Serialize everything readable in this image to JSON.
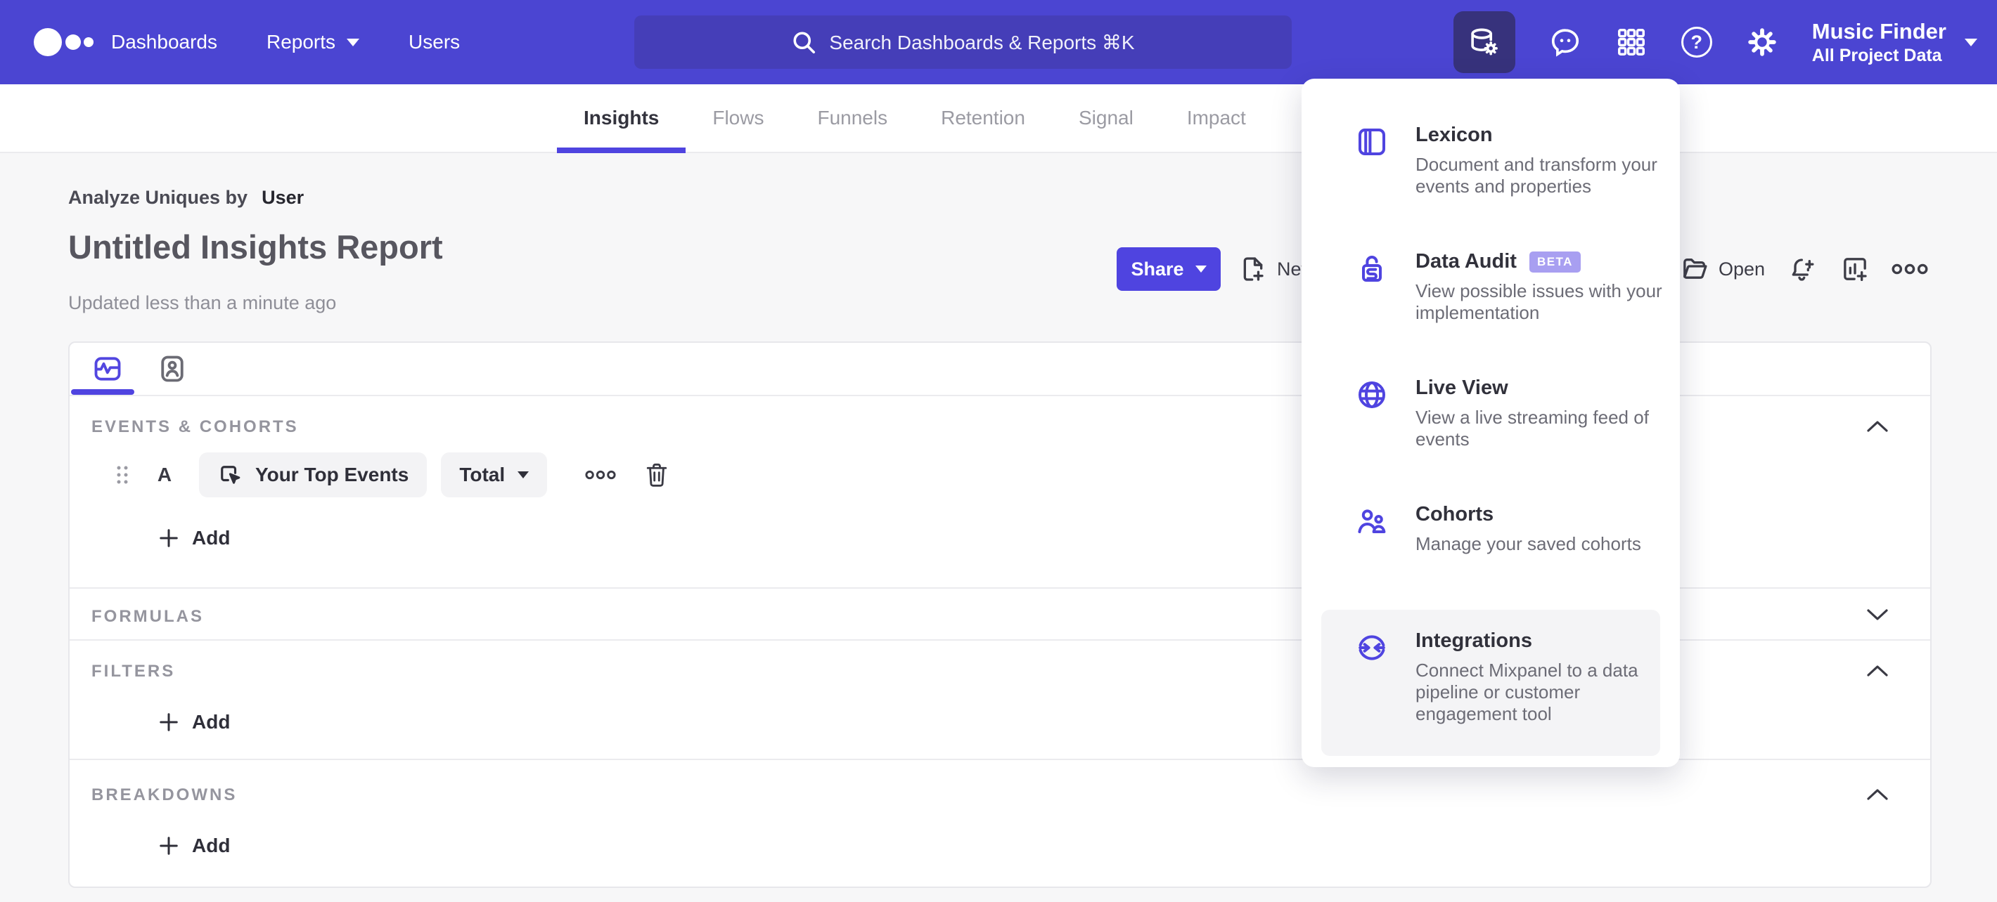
{
  "nav": {
    "items": [
      {
        "label": "Dashboards"
      },
      {
        "label": "Reports"
      },
      {
        "label": "Users"
      }
    ],
    "search_placeholder": "Search Dashboards & Reports ⌘K",
    "icons": [
      "mixpanel-logo",
      "data-management",
      "feedback",
      "apps-grid",
      "help",
      "settings"
    ],
    "help_glyph": "?",
    "project": {
      "name": "Music Finder",
      "scope": "All Project Data"
    }
  },
  "tabs": {
    "items": [
      "Insights",
      "Flows",
      "Funnels",
      "Retention",
      "Signal",
      "Impact"
    ],
    "active": "Insights"
  },
  "report": {
    "eyebrow_prefix": "Analyze Uniques by",
    "eyebrow_value": "User",
    "title": "Untitled Insights Report",
    "updated": "Updated less than a minute ago"
  },
  "toolbar": {
    "share_label": "Share",
    "new_label": "New",
    "open_label": "Open"
  },
  "builder": {
    "events": {
      "label": "EVENTS & COHORTS",
      "row_letter": "A",
      "event_name": "Your Top Events",
      "metric": "Total",
      "add_label": "Add"
    },
    "formulas": {
      "label": "FORMULAS"
    },
    "filters": {
      "label": "FILTERS",
      "add_label": "Add"
    },
    "breakdowns": {
      "label": "BREAKDOWNS",
      "add_label": "Add"
    }
  },
  "menu": {
    "items": [
      {
        "title": "Lexicon",
        "desc": "Document and transform your events and properties"
      },
      {
        "title": "Data Audit",
        "badge": "BETA",
        "desc": "View possible issues with your implementation"
      },
      {
        "title": "Live View",
        "desc": "View a live streaming feed of events"
      },
      {
        "title": "Cohorts",
        "desc": "Manage your saved cohorts"
      },
      {
        "title": "Integrations",
        "desc": "Connect Mixpanel to a data pipeline or customer engagement tool"
      }
    ]
  },
  "colors": {
    "nav_bg": "#4b45d2",
    "search_bg": "#453eb8",
    "accent": "#4f44e0",
    "active_tile_bg": "#37327c",
    "beta_badge_bg": "#a89ff1",
    "page_bg": "#f7f7f8"
  }
}
